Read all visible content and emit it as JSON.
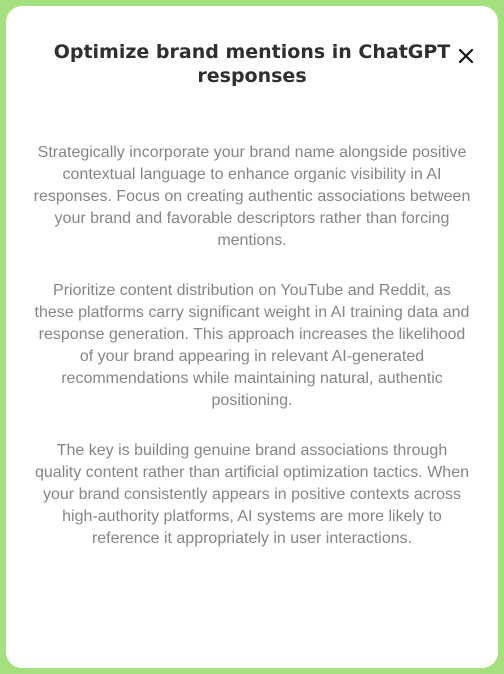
{
  "modal": {
    "title": "Optimize brand mentions in ChatGPT responses",
    "close_icon": "close-icon",
    "paragraphs": [
      "Strategically incorporate your brand name alongside positive contextual language to enhance organic visibility in AI responses. Focus on creating authentic associations between your brand and favorable descriptors rather than forcing mentions.",
      "Prioritize content distribution on YouTube and Reddit, as these platforms carry significant weight in AI training data and response generation. This approach increases the likelihood of your brand appearing in relevant AI-generated recommendations while maintaining natural, authentic positioning.",
      "The key is building genuine brand associations through quality content rather than artificial optimization tactics. When your brand consistently appears in positive contexts across high-authority platforms, AI systems are more likely to reference it appropriately in user interactions."
    ]
  },
  "colors": {
    "background": "#a4e07e",
    "panel": "#ffffff",
    "title": "#2f2f2f",
    "body_text": "#858585"
  }
}
